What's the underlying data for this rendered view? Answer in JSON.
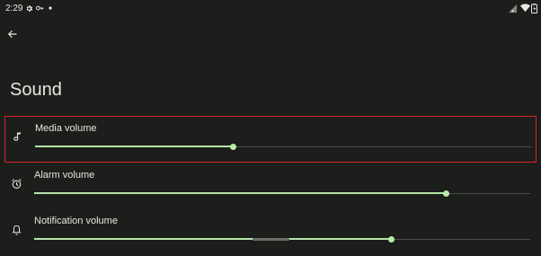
{
  "status_bar": {
    "time": "2:29",
    "left_icons": [
      "gear-icon",
      "vpn-key-icon",
      "dot-icon"
    ],
    "right_icons": [
      "signal-icon",
      "wifi-icon",
      "battery-icon"
    ]
  },
  "header": {
    "back_icon": "arrow-back-icon"
  },
  "page": {
    "title": "Sound"
  },
  "settings": [
    {
      "label": "Media volume",
      "icon": "music-note-icon",
      "value_fraction": 0.4,
      "highlighted": true
    },
    {
      "label": "Alarm volume",
      "icon": "alarm-clock-icon",
      "value_fraction": 0.83,
      "highlighted": false
    },
    {
      "label": "Notification volume",
      "icon": "bell-icon",
      "value_fraction": 0.72,
      "highlighted": false
    }
  ],
  "colors": {
    "background": "#1c1e1b",
    "slider_active": "#b4e5a8",
    "slider_inactive": "#4b4e4a",
    "highlight_border": "#d8232a"
  }
}
